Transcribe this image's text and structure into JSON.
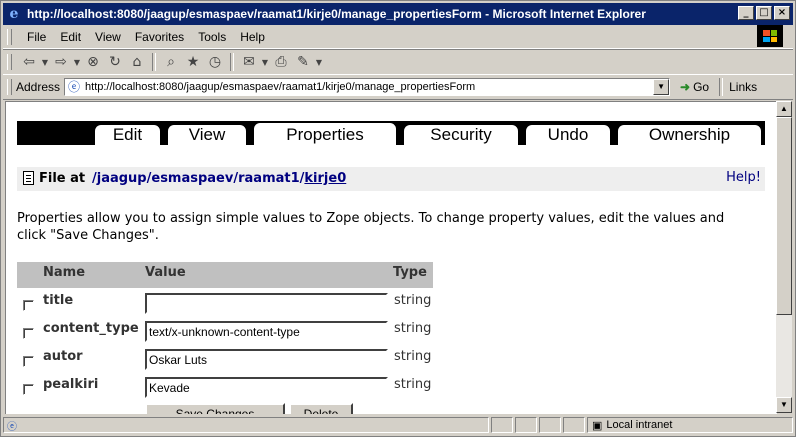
{
  "window": {
    "title": "http://localhost:8080/jaagup/esmaspaev/raamat1/kirje0/manage_propertiesForm - Microsoft Internet Explorer"
  },
  "menu": {
    "items": [
      {
        "label": "File"
      },
      {
        "label": "Edit"
      },
      {
        "label": "View"
      },
      {
        "label": "Favorites"
      },
      {
        "label": "Tools"
      },
      {
        "label": "Help"
      }
    ]
  },
  "address": {
    "label": "Address",
    "url": "http://localhost:8080/jaagup/esmaspaev/raamat1/kirje0/manage_propertiesForm",
    "go_label": "Go",
    "links_label": "Links"
  },
  "tabs": [
    {
      "label": "Edit"
    },
    {
      "label": "View"
    },
    {
      "label": "Properties",
      "active": true
    },
    {
      "label": "Security"
    },
    {
      "label": "Undo"
    },
    {
      "label": "Ownership"
    }
  ],
  "location": {
    "prefix": "File at",
    "path_parts": [
      "/jaagup",
      "/esmaspaev",
      "/raamat1",
      "/",
      "kirje0"
    ],
    "help": "Help!"
  },
  "intro": "Properties allow you to assign simple values to Zope objects. To change property values, edit the values and click \"Save Changes\".",
  "table": {
    "headers": {
      "name": "Name",
      "value": "Value",
      "type": "Type"
    },
    "rows": [
      {
        "name": "title",
        "value": "",
        "type": "string"
      },
      {
        "name": "content_type",
        "value": "text/x-unknown-content-type",
        "type": "string"
      },
      {
        "name": "autor",
        "value": "Oskar Luts",
        "type": "string"
      },
      {
        "name": "pealkiri",
        "value": "Kevade",
        "type": "string"
      }
    ]
  },
  "buttons": {
    "save": "Save Changes",
    "delete": "Delete"
  },
  "status": {
    "zone": "Local intranet"
  }
}
